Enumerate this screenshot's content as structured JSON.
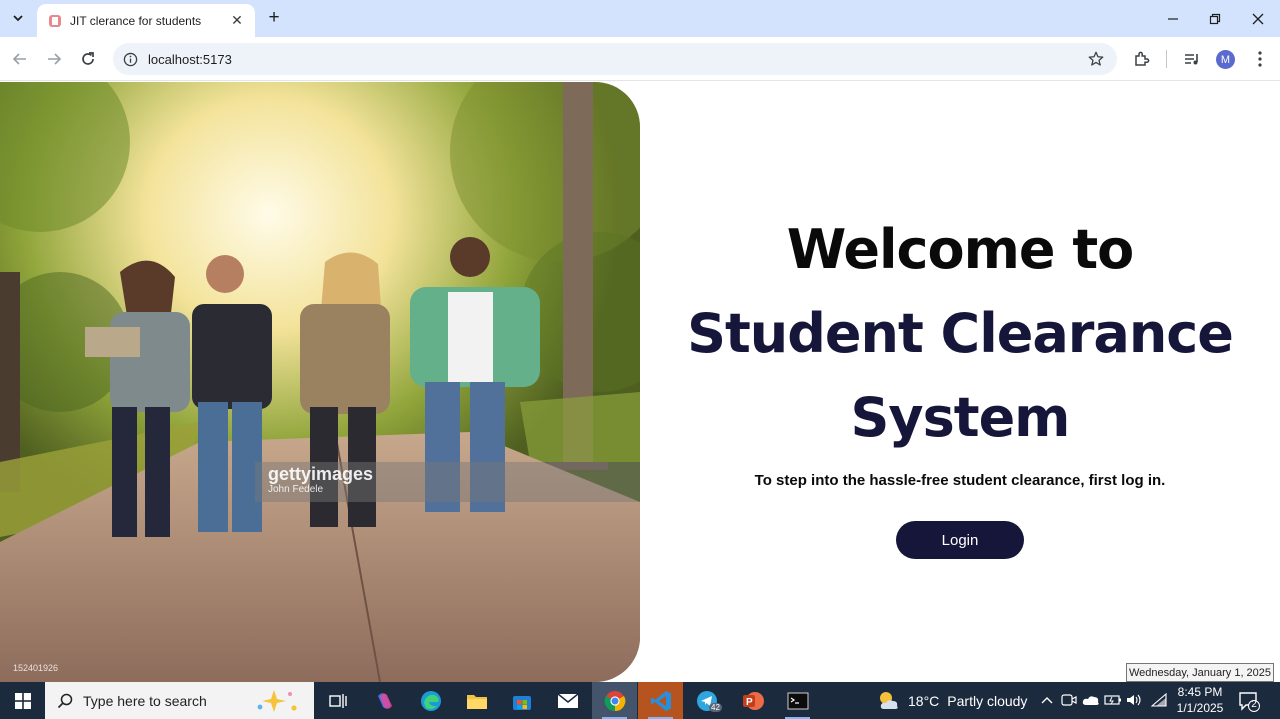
{
  "browser": {
    "tab_title": "JIT clerance for students",
    "url": "localhost:5173",
    "avatar_letter": "M"
  },
  "hero": {
    "watermark_brand": "gettyimages",
    "watermark_author": "John Fedele",
    "image_id": "152401926"
  },
  "welcome": {
    "line1": "Welcome to",
    "line2": "Student Clearance",
    "line3": "System",
    "subtitle": "To step into the hassle-free student clearance, first log in.",
    "login_label": "Login"
  },
  "tooltip": {
    "date": "Wednesday, January 1, 2025"
  },
  "taskbar": {
    "search_placeholder": "Type here to search",
    "weather_temp": "18°C",
    "weather_desc": "Partly cloudy",
    "telegram_badge": "42",
    "notification_count": "2",
    "time": "8:45 PM",
    "date": "1/1/2025"
  },
  "colors": {
    "brand_dark": "#16163a",
    "tabbar_bg": "#d3e3fd",
    "taskbar_bg": "#1c2a3d"
  }
}
